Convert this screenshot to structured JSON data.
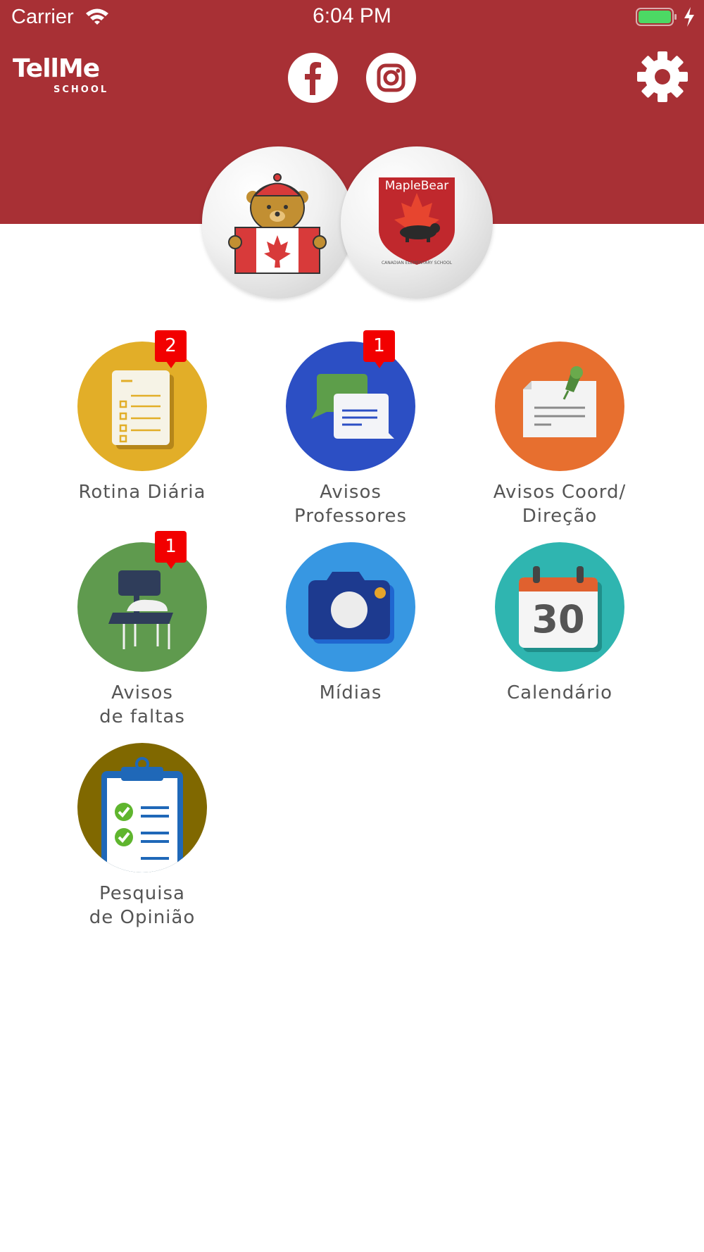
{
  "status_bar": {
    "carrier": "Carrier",
    "time": "6:04 PM"
  },
  "header": {
    "logo_text": "TellMe",
    "logo_subtext": "SCHOOL",
    "color": "#a83035",
    "social": [
      "facebook-icon",
      "instagram-icon"
    ],
    "settings_icon": "gear-icon"
  },
  "schools": {
    "mascot": "bear-mascot-logo",
    "brand": {
      "title": "MapleBear",
      "subtitle": "CANADIAN ELEMENTARY SCHOOL"
    }
  },
  "menu": {
    "items": [
      {
        "label": "Rotina Diária",
        "badge": "2",
        "color": "#e2ae28",
        "icon": "checklist-document-icon"
      },
      {
        "label": "Avisos\nProfessores",
        "badge": "1",
        "color": "#2c4fc4",
        "icon": "chat-bubbles-icon"
      },
      {
        "label": "Avisos Coord/\nDireção",
        "badge": "",
        "color": "#e76f2f",
        "icon": "pinned-note-icon"
      },
      {
        "label": "Avisos\nde faltas",
        "badge": "1",
        "color": "#5f9a4e",
        "icon": "school-desk-icon"
      },
      {
        "label": "Mídias",
        "badge": "",
        "color": "#3797e2",
        "icon": "camera-icon"
      },
      {
        "label": "Calendário",
        "badge": "",
        "color": "#2fb5b0",
        "icon": "calendar-icon",
        "calendar_day": "30"
      },
      {
        "label": "Pesquisa\nde Opinião",
        "badge": "",
        "color": "#806800",
        "icon": "survey-clipboard-icon"
      }
    ]
  }
}
